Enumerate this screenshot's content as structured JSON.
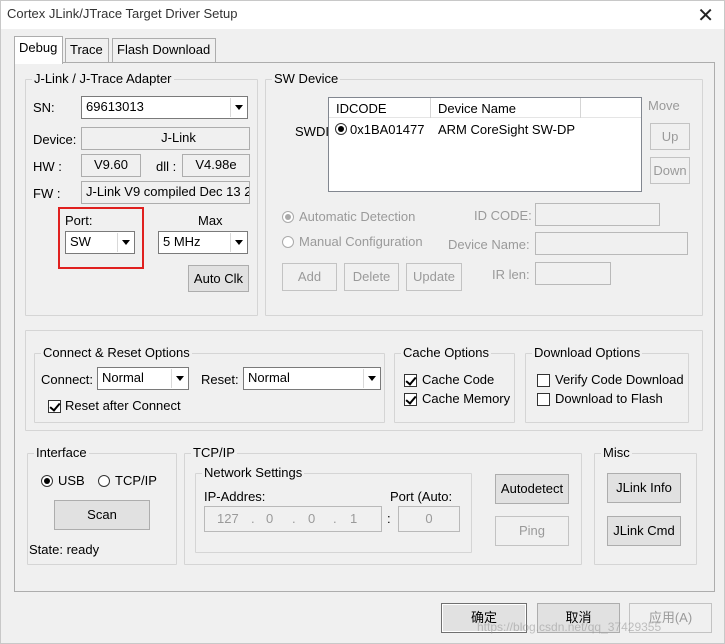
{
  "window": {
    "title": "Cortex JLink/JTrace Target Driver Setup",
    "close_glyph": "✕"
  },
  "tabs": [
    {
      "label": "Debug"
    },
    {
      "label": "Trace"
    },
    {
      "label": "Flash Download"
    }
  ],
  "adapter": {
    "caption": "J-Link / J-Trace Adapter",
    "sn_label": "SN:",
    "sn_value": "69613013",
    "device_label": "Device:",
    "device_value": "J-Link",
    "hw_label": "HW :",
    "hw_value": "V9.60",
    "dll_label": "dll :",
    "dll_value": "V4.98e",
    "fw_label": "FW :",
    "fw_value": "J-Link V9 compiled Dec 13 2",
    "port_label": "Port:",
    "port_value": "SW",
    "max_label": "Max",
    "max_value": "5 MHz",
    "autoclk_label": "Auto Clk"
  },
  "sw_device": {
    "caption": "SW Device",
    "row_label": "SWDI",
    "columns": [
      "IDCODE",
      "Device Name"
    ],
    "rows": [
      {
        "idcode": "0x1BA01477",
        "name": "ARM CoreSight SW-DP"
      }
    ],
    "move_label": "Move",
    "up_label": "Up",
    "down_label": "Down",
    "auto_detect_label": "Automatic Detection",
    "manual_config_label": "Manual Configuration",
    "id_code_label": "ID CODE:",
    "device_name_label": "Device Name:",
    "ir_len_label": "IR len:",
    "add_label": "Add",
    "delete_label": "Delete",
    "update_label": "Update"
  },
  "connect_reset": {
    "caption": "Connect & Reset Options",
    "connect_label": "Connect:",
    "connect_value": "Normal",
    "reset_label": "Reset:",
    "reset_value": "Normal",
    "reset_after_connect_label": "Reset after Connect"
  },
  "cache": {
    "caption": "Cache Options",
    "code_label": "Cache Code",
    "memory_label": "Cache Memory"
  },
  "download": {
    "caption": "Download Options",
    "verify_label": "Verify Code Download",
    "flash_label": "Download to Flash"
  },
  "interface": {
    "caption": "Interface",
    "usb_label": "USB",
    "tcpip_label": "TCP/IP",
    "scan_label": "Scan",
    "state_text": "State: ready"
  },
  "tcpip": {
    "caption": "TCP/IP",
    "network_caption": "Network Settings",
    "ip_label": "IP-Addres:",
    "ip_parts": [
      "127",
      "0",
      "0",
      "1"
    ],
    "ip_dot": ".",
    "port_label": "Port (Auto:",
    "port_colon": ":",
    "port_value": "0",
    "autodetect_label": "Autodetect",
    "ping_label": "Ping"
  },
  "misc": {
    "caption": "Misc",
    "jlink_info_label": "JLink Info",
    "jlink_cmd_label": "JLink Cmd"
  },
  "footer": {
    "ok_label": "确定",
    "cancel_label": "取消",
    "apply_label": "应用(A)",
    "watermark": "https://blog.csdn.net/qq_37429355"
  }
}
